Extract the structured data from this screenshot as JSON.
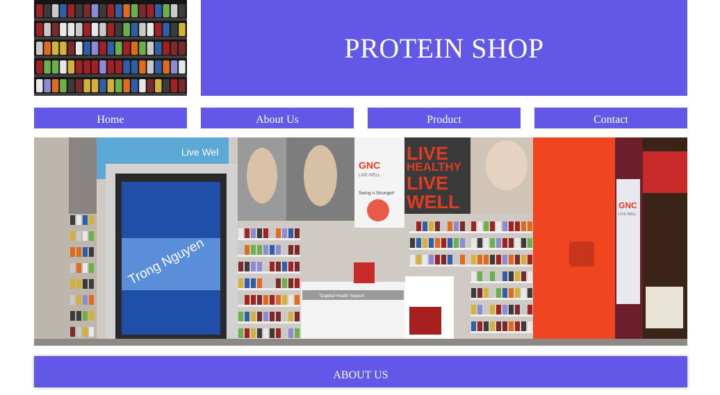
{
  "header": {
    "logo_image": "protein-shelf-photo",
    "title": "PROTEIN SHOP"
  },
  "nav": {
    "items": [
      "Home",
      "About Us",
      "Product",
      "Contact"
    ]
  },
  "hero": {
    "image": "gnc-store-photo",
    "sign_brand": "GNC",
    "sign_tagline": "LIVE WELL",
    "sign_slogan_lines": [
      "LIVE",
      "HEALTHY",
      "LIVE",
      "WELL"
    ],
    "sign_strong": "Swing o Stronger!",
    "watermark": "Trong Nguyen",
    "side_brand": "GNC",
    "side_tagline": "LIVE WELL",
    "shelf_sign_1": "Targeted Health Support",
    "wall_sign": "Live Wel"
  },
  "about": {
    "heading": "ABOUT US"
  },
  "colors": {
    "accent": "#6357e8",
    "accent_text": "#ffffff",
    "background": "#ffffff",
    "gnc_red": "#e23b24",
    "orange_wall": "#f0451e"
  }
}
